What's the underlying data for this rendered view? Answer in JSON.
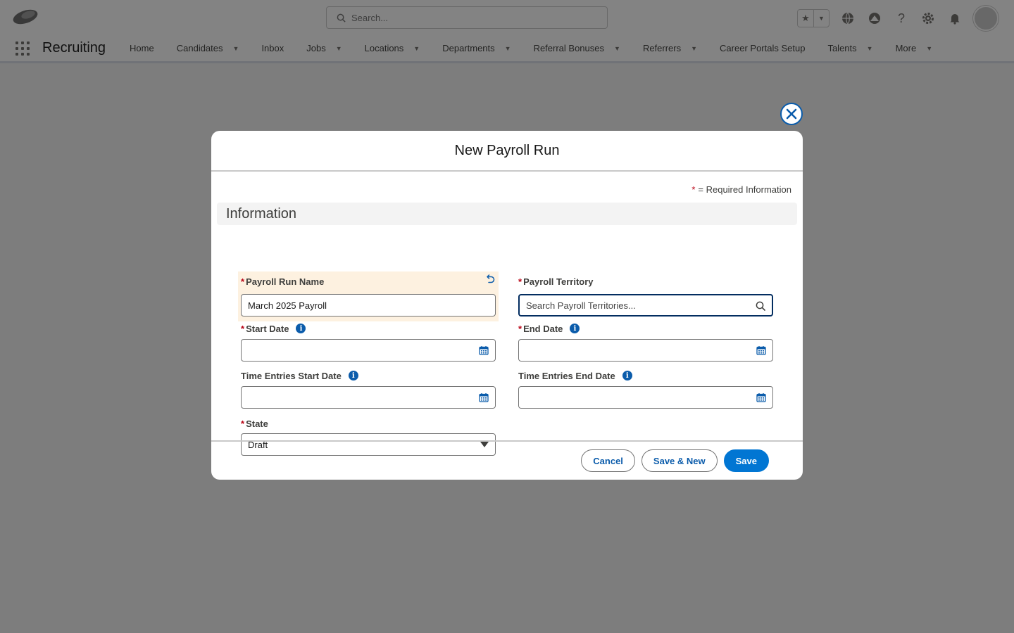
{
  "header": {
    "search_placeholder": "Search..."
  },
  "navbar": {
    "app_name": "Recruiting",
    "items": [
      {
        "label": "Home",
        "has_menu": false
      },
      {
        "label": "Candidates",
        "has_menu": true
      },
      {
        "label": "Inbox",
        "has_menu": false
      },
      {
        "label": "Jobs",
        "has_menu": true
      },
      {
        "label": "Locations",
        "has_menu": true
      },
      {
        "label": "Departments",
        "has_menu": true
      },
      {
        "label": "Referral Bonuses",
        "has_menu": true
      },
      {
        "label": "Referrers",
        "has_menu": true
      },
      {
        "label": "Career Portals Setup",
        "has_menu": false
      },
      {
        "label": "Talents",
        "has_menu": true
      },
      {
        "label": "More",
        "has_menu": true
      }
    ]
  },
  "modal": {
    "title": "New Payroll Run",
    "required_note": "= Required Information",
    "section_title": "Information",
    "fields": {
      "payroll_run_name": {
        "label": "Payroll Run Name",
        "value": "March 2025 Payroll"
      },
      "payroll_territory": {
        "label": "Payroll Territory",
        "placeholder": "Search Payroll Territories..."
      },
      "start_date": {
        "label": "Start Date",
        "value": ""
      },
      "end_date": {
        "label": "End Date",
        "value": ""
      },
      "time_entries_start_date": {
        "label": "Time Entries Start Date",
        "value": ""
      },
      "time_entries_end_date": {
        "label": "Time Entries End Date",
        "value": ""
      },
      "state": {
        "label": "State",
        "value": "Draft"
      }
    },
    "buttons": {
      "cancel": "Cancel",
      "save_new": "Save & New",
      "save": "Save"
    }
  },
  "colors": {
    "brand": "#0176d3",
    "required": "#ba0517",
    "highlight": "#fdf1e0",
    "focus_border": "#032d60"
  },
  "icons": [
    "search-icon",
    "star-icon",
    "globe-icon",
    "help-icon",
    "gear-icon",
    "bell-icon",
    "close-icon",
    "undo-icon",
    "info-icon",
    "calendar-icon",
    "chevron-down-icon"
  ]
}
